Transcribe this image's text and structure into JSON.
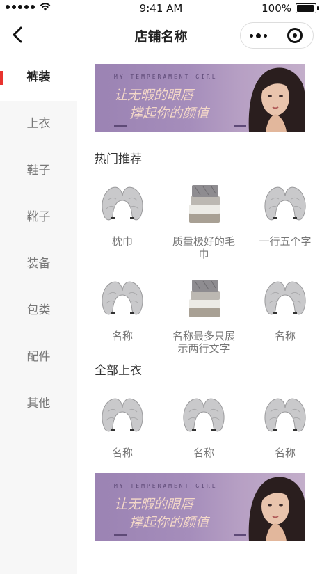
{
  "status": {
    "time": "9:41 AM",
    "battery": "100%"
  },
  "nav": {
    "title": "店铺名称"
  },
  "sidebar": {
    "items": [
      {
        "label": "裤装",
        "active": true
      },
      {
        "label": "上衣"
      },
      {
        "label": "鞋子"
      },
      {
        "label": "靴子"
      },
      {
        "label": "装备"
      },
      {
        "label": "包类"
      },
      {
        "label": "配件"
      },
      {
        "label": "其他"
      }
    ]
  },
  "banner": {
    "en": "MY TEMPERAMENT GIRL",
    "line1": "让无暇的眼唇",
    "line2": "撑起你的颜值"
  },
  "hot": {
    "title": "热门推荐",
    "items": [
      {
        "name": "枕巾",
        "img": "pillow"
      },
      {
        "name": "质量极好的毛巾",
        "img": "towel"
      },
      {
        "name": "一行五个字",
        "img": "pillow"
      },
      {
        "name": "名称",
        "img": "pillow"
      },
      {
        "name": "名称最多只展示两行文字",
        "img": "towel"
      },
      {
        "name": "名称",
        "img": "pillow"
      }
    ]
  },
  "all": {
    "title": "全部上衣",
    "items": [
      {
        "name": "名称",
        "img": "pillow"
      },
      {
        "name": "名称",
        "img": "pillow"
      },
      {
        "name": "名称",
        "img": "pillow"
      }
    ]
  },
  "colors": {
    "accent": "#e8332e",
    "sidebar_bg": "#f7f7f7",
    "banner": "#a58dbb"
  }
}
